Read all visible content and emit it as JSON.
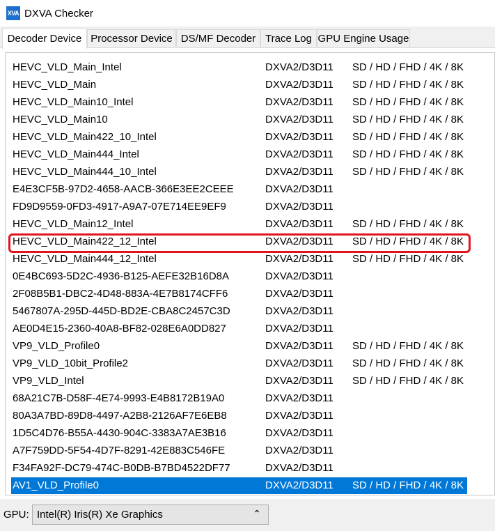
{
  "window": {
    "title": "DXVA Checker",
    "icon_text": "XVA"
  },
  "tabs": [
    {
      "label": "Decoder Device",
      "active": true
    },
    {
      "label": "Processor Device",
      "active": false
    },
    {
      "label": "DS/MF Decoder",
      "active": false
    },
    {
      "label": "Trace Log",
      "active": false
    },
    {
      "label": "GPU Engine Usage",
      "active": false
    }
  ],
  "decoders": [
    {
      "name": "HEVC_VLD_Main_Intel",
      "api": "DXVA2/D3D11",
      "res": "SD / HD / FHD / 4K / 8K"
    },
    {
      "name": "HEVC_VLD_Main",
      "api": "DXVA2/D3D11",
      "res": "SD / HD / FHD / 4K / 8K"
    },
    {
      "name": "HEVC_VLD_Main10_Intel",
      "api": "DXVA2/D3D11",
      "res": "SD / HD / FHD / 4K / 8K"
    },
    {
      "name": "HEVC_VLD_Main10",
      "api": "DXVA2/D3D11",
      "res": "SD / HD / FHD / 4K / 8K"
    },
    {
      "name": "HEVC_VLD_Main422_10_Intel",
      "api": "DXVA2/D3D11",
      "res": "SD / HD / FHD / 4K / 8K"
    },
    {
      "name": "HEVC_VLD_Main444_Intel",
      "api": "DXVA2/D3D11",
      "res": "SD / HD / FHD / 4K / 8K"
    },
    {
      "name": "HEVC_VLD_Main444_10_Intel",
      "api": "DXVA2/D3D11",
      "res": "SD / HD / FHD / 4K / 8K"
    },
    {
      "name": "E4E3CF5B-97D2-4658-AACB-366E3EE2CEEE",
      "api": "DXVA2/D3D11",
      "res": ""
    },
    {
      "name": "FD9D9559-0FD3-4917-A9A7-07E714EE9EF9",
      "api": "DXVA2/D3D11",
      "res": ""
    },
    {
      "name": "HEVC_VLD_Main12_Intel",
      "api": "DXVA2/D3D11",
      "res": "SD / HD / FHD / 4K / 8K"
    },
    {
      "name": "HEVC_VLD_Main422_12_Intel",
      "api": "DXVA2/D3D11",
      "res": "SD / HD / FHD / 4K / 8K"
    },
    {
      "name": "HEVC_VLD_Main444_12_Intel",
      "api": "DXVA2/D3D11",
      "res": "SD / HD / FHD / 4K / 8K"
    },
    {
      "name": "0E4BC693-5D2C-4936-B125-AEFE32B16D8A",
      "api": "DXVA2/D3D11",
      "res": ""
    },
    {
      "name": "2F08B5B1-DBC2-4D48-883A-4E7B8174CFF6",
      "api": "DXVA2/D3D11",
      "res": ""
    },
    {
      "name": "5467807A-295D-445D-BD2E-CBA8C2457C3D",
      "api": "DXVA2/D3D11",
      "res": ""
    },
    {
      "name": "AE0D4E15-2360-40A8-BF82-028E6A0DD827",
      "api": "DXVA2/D3D11",
      "res": ""
    },
    {
      "name": "VP9_VLD_Profile0",
      "api": "DXVA2/D3D11",
      "res": "SD / HD / FHD / 4K / 8K"
    },
    {
      "name": "VP9_VLD_10bit_Profile2",
      "api": "DXVA2/D3D11",
      "res": "SD / HD / FHD / 4K / 8K"
    },
    {
      "name": "VP9_VLD_Intel",
      "api": "DXVA2/D3D11",
      "res": "SD / HD / FHD / 4K / 8K"
    },
    {
      "name": "68A21C7B-D58F-4E74-9993-E4B8172B19A0",
      "api": "DXVA2/D3D11",
      "res": ""
    },
    {
      "name": "80A3A7BD-89D8-4497-A2B8-2126AF7E6EB8",
      "api": "DXVA2/D3D11",
      "res": ""
    },
    {
      "name": "1D5C4D76-B55A-4430-904C-3383A7AE3B16",
      "api": "DXVA2/D3D11",
      "res": ""
    },
    {
      "name": "A7F759DD-5F54-4D7F-8291-42E883C546FE",
      "api": "DXVA2/D3D11",
      "res": ""
    },
    {
      "name": "F34FA92F-DC79-474C-B0DB-B7BD4522DF77",
      "api": "DXVA2/D3D11",
      "res": ""
    },
    {
      "name": "AV1_VLD_Profile0",
      "api": "DXVA2/D3D11",
      "res": "SD / HD / FHD / 4K / 8K",
      "selected": true
    }
  ],
  "footer": {
    "gpu_label": "GPU:",
    "gpu_value": "Intel(R) Iris(R) Xe Graphics"
  },
  "colors": {
    "selection": "#0078d7",
    "annotation": "#e0141e"
  }
}
